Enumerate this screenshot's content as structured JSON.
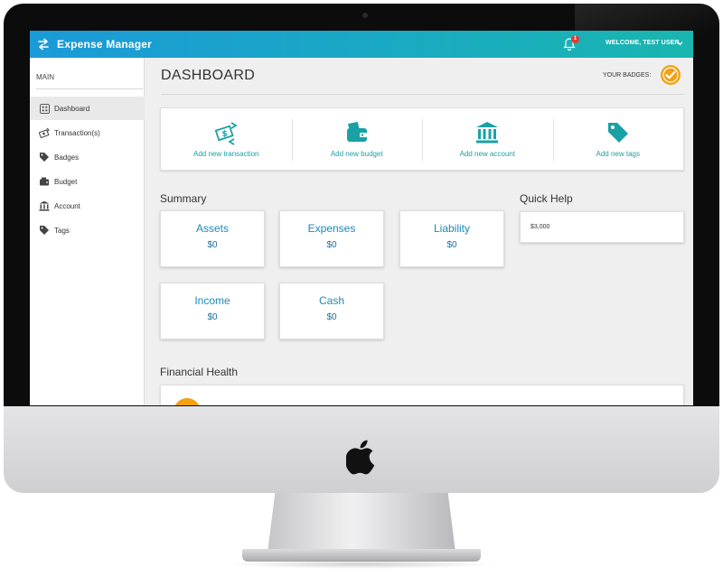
{
  "app": {
    "title": "Expense Manager",
    "notification_count": "1",
    "welcome": "WELCOME, TEST USER"
  },
  "sidebar": {
    "heading": "MAIN",
    "items": [
      {
        "label": "Dashboard",
        "icon": "dashboard-icon",
        "active": true
      },
      {
        "label": "Transaction(s)",
        "icon": "money-icon",
        "active": false
      },
      {
        "label": "Badges",
        "icon": "tag-icon",
        "active": false
      },
      {
        "label": "Budget",
        "icon": "wallet-icon",
        "active": false
      },
      {
        "label": "Account",
        "icon": "bank-icon",
        "active": false
      },
      {
        "label": "Tags",
        "icon": "tag-icon",
        "active": false
      }
    ]
  },
  "header": {
    "title": "DASHBOARD",
    "badges_label": "YOUR BADGES:"
  },
  "quick_actions": [
    {
      "label": "Add new transaction",
      "icon": "money-transfer-icon"
    },
    {
      "label": "Add new budget",
      "icon": "wallet-icon"
    },
    {
      "label": "Add new account",
      "icon": "bank-icon"
    },
    {
      "label": "Add new tags",
      "icon": "tags-icon"
    }
  ],
  "summary": {
    "heading": "Summary",
    "cards": [
      {
        "title": "Assets",
        "value": "$0"
      },
      {
        "title": "Expenses",
        "value": "$0"
      },
      {
        "title": "Liability",
        "value": "$0"
      },
      {
        "title": "Income",
        "value": "$0"
      },
      {
        "title": "Cash",
        "value": "$0"
      }
    ]
  },
  "quick_help": {
    "heading": "Quick Help",
    "text": "$3,000"
  },
  "financial_health": {
    "heading": "Financial Health"
  },
  "colors": {
    "accent": "#1aa1a6",
    "topbar_start": "#1b9ad8",
    "topbar_end": "#19b6b0",
    "badge": "#f3a011",
    "alert": "#e53935"
  }
}
